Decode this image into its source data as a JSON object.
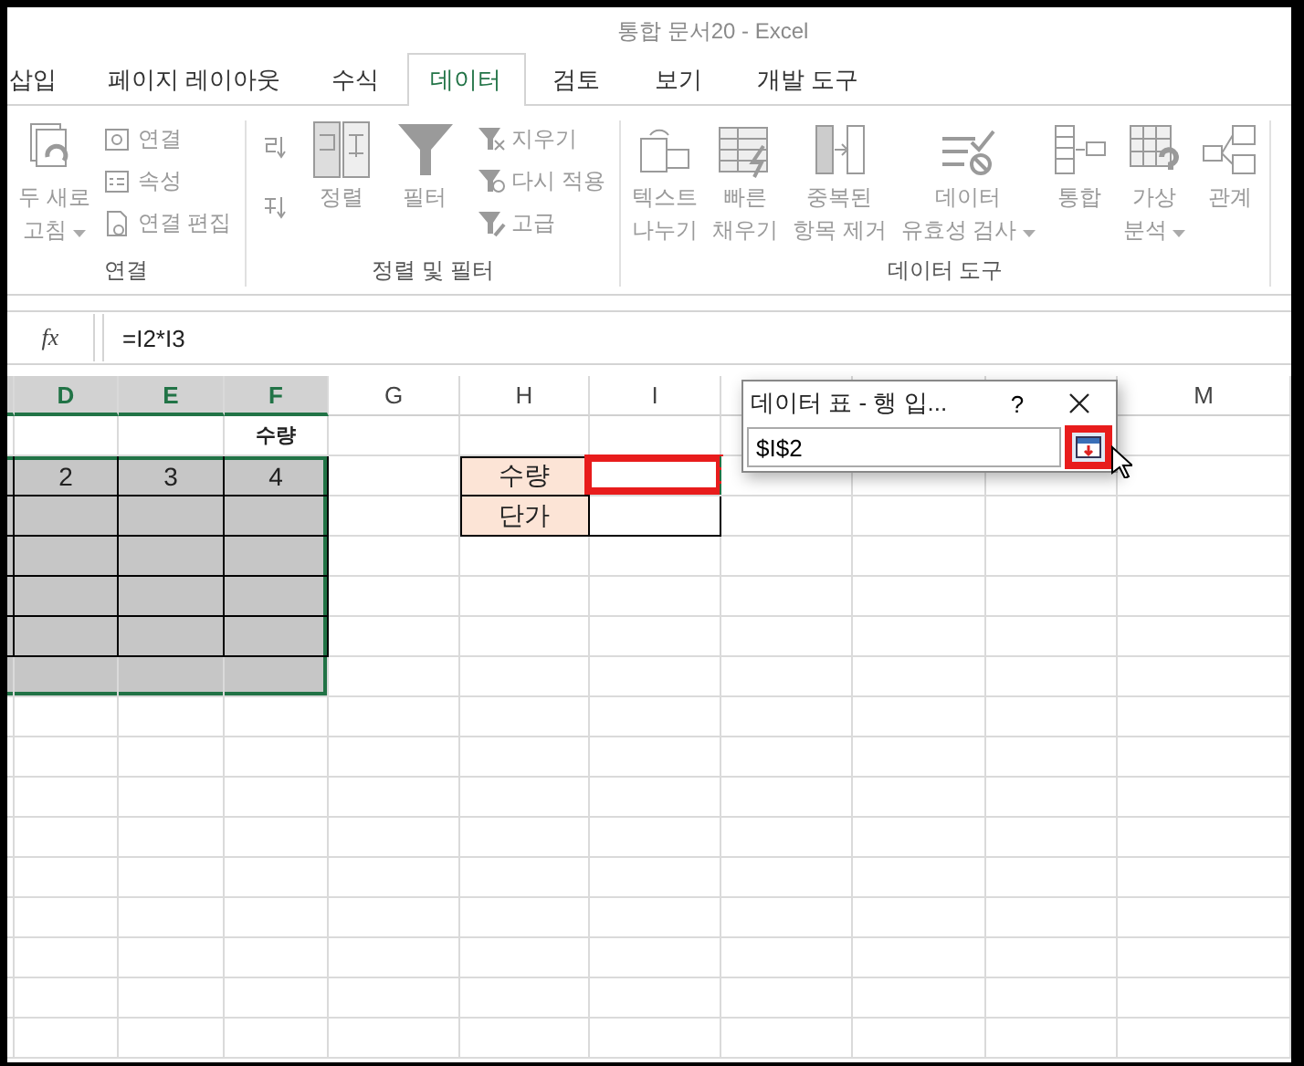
{
  "window": {
    "title": "통합 문서20 - Excel"
  },
  "tabs": [
    {
      "label": "삽입",
      "selected": false
    },
    {
      "label": "페이지 레이아웃",
      "selected": false
    },
    {
      "label": "수식",
      "selected": false
    },
    {
      "label": "데이터",
      "selected": true
    },
    {
      "label": "검토",
      "selected": false
    },
    {
      "label": "보기",
      "selected": false
    },
    {
      "label": "개발 도구",
      "selected": false
    }
  ],
  "ribbon": {
    "groups": [
      {
        "label": "연결",
        "buttons": [
          {
            "kind": "large",
            "lines": [
              "두 새로",
              "고침"
            ],
            "dropdown": true,
            "disabled": true
          },
          {
            "kind": "column",
            "items": [
              {
                "label": "연결",
                "disabled": true
              },
              {
                "label": "속성",
                "disabled": true
              },
              {
                "label": "연결 편집",
                "disabled": true
              }
            ]
          }
        ]
      },
      {
        "label": "정렬 및 필터",
        "buttons": [
          {
            "kind": "column",
            "items": [
              {
                "disabled": true
              },
              {
                "disabled": true
              }
            ]
          },
          {
            "kind": "large",
            "lines": [
              "정렬"
            ],
            "dropdown": false,
            "disabled": true
          },
          {
            "kind": "large",
            "lines": [
              "필터"
            ],
            "dropdown": false,
            "disabled": true
          },
          {
            "kind": "column",
            "items": [
              {
                "label": "지우기",
                "disabled": true
              },
              {
                "label": "다시 적용",
                "disabled": true
              },
              {
                "label": "고급",
                "disabled": true
              }
            ]
          }
        ]
      },
      {
        "label": "데이터 도구",
        "buttons": [
          {
            "kind": "large",
            "lines": [
              "텍스트",
              "나누기"
            ],
            "dropdown": false,
            "disabled": true
          },
          {
            "kind": "large",
            "lines": [
              "빠른",
              "채우기"
            ],
            "dropdown": false,
            "disabled": true
          },
          {
            "kind": "large",
            "lines": [
              "중복된",
              "항목 제거"
            ],
            "dropdown": false,
            "disabled": true
          },
          {
            "kind": "large",
            "lines": [
              "데이터",
              "유효성 검사"
            ],
            "dropdown": true,
            "disabled": true
          },
          {
            "kind": "large",
            "lines": [
              "통합"
            ],
            "dropdown": false,
            "disabled": true
          },
          {
            "kind": "large",
            "lines": [
              "가상",
              "분석"
            ],
            "dropdown": true,
            "disabled": true
          },
          {
            "kind": "large",
            "lines": [
              "관계"
            ],
            "dropdown": false,
            "disabled": true
          }
        ]
      }
    ]
  },
  "formula_bar": {
    "function_label": "fx",
    "formula": "=I2*I3"
  },
  "grid": {
    "columns": [
      {
        "kind": "cut"
      },
      {
        "kind": "full",
        "label": "D"
      },
      {
        "kind": "full",
        "label": "E"
      },
      {
        "kind": "full",
        "label": "F"
      },
      {
        "kind": "full",
        "label": "G"
      },
      {
        "kind": "full",
        "label": "H"
      },
      {
        "kind": "full",
        "label": "I"
      },
      {
        "kind": "covered"
      },
      {
        "kind": "covered"
      },
      {
        "kind": "covered"
      },
      {
        "kind": "full",
        "label": "M"
      }
    ],
    "rows": [
      [
        {
          "kind": "plain",
          "selected": false
        },
        {
          "kind": "plain",
          "selected": false
        },
        {
          "kind": "plain",
          "selected": false
        },
        {
          "kind": "heading",
          "selected": false,
          "text": "수량"
        },
        {
          "kind": "plain",
          "selected": false
        },
        {
          "kind": "plain",
          "selected": false
        },
        {
          "kind": "plain",
          "selected": false
        },
        {
          "kind": "plain",
          "selected": false
        },
        {
          "kind": "covered"
        },
        {
          "kind": "covered"
        },
        {
          "kind": "plain",
          "selected": false
        }
      ],
      [
        {
          "kind": "table",
          "selected": true
        },
        {
          "kind": "table",
          "selected": true,
          "text": "2"
        },
        {
          "kind": "table",
          "selected": true,
          "text": "3"
        },
        {
          "kind": "table",
          "selected": true,
          "text": "4"
        },
        {
          "kind": "plain",
          "selected": false
        },
        {
          "kind": "label",
          "selected": false,
          "text": "수량"
        },
        {
          "kind": "target",
          "selected": false
        },
        {
          "kind": "plain",
          "selected": false
        },
        {
          "kind": "plain",
          "selected": false
        },
        {
          "kind": "plain",
          "selected": false
        },
        {
          "kind": "plain",
          "selected": false
        }
      ],
      [
        {
          "kind": "table",
          "selected": true
        },
        {
          "kind": "table",
          "selected": true
        },
        {
          "kind": "table",
          "selected": true
        },
        {
          "kind": "table",
          "selected": true
        },
        {
          "kind": "plain",
          "selected": false
        },
        {
          "kind": "label",
          "selected": false,
          "text": "단가"
        },
        {
          "kind": "boxed",
          "selected": false
        },
        {
          "kind": "plain",
          "selected": false
        },
        {
          "kind": "plain",
          "selected": false
        },
        {
          "kind": "plain",
          "selected": false
        },
        {
          "kind": "plain",
          "selected": false
        }
      ],
      [
        {
          "kind": "table",
          "selected": true
        },
        {
          "kind": "table",
          "selected": true
        },
        {
          "kind": "table",
          "selected": true
        },
        {
          "kind": "table",
          "selected": true
        },
        {
          "kind": "plain",
          "selected": false
        },
        {
          "kind": "plain",
          "selected": false
        },
        {
          "kind": "plain",
          "selected": false
        },
        {
          "kind": "plain",
          "selected": false
        },
        {
          "kind": "plain",
          "selected": false
        },
        {
          "kind": "plain",
          "selected": false
        },
        {
          "kind": "plain",
          "selected": false
        }
      ],
      [
        {
          "kind": "table",
          "selected": true
        },
        {
          "kind": "table",
          "selected": true
        },
        {
          "kind": "table",
          "selected": true
        },
        {
          "kind": "table",
          "selected": true
        },
        {
          "kind": "plain",
          "selected": false
        },
        {
          "kind": "plain",
          "selected": false
        },
        {
          "kind": "plain",
          "selected": false
        },
        {
          "kind": "plain",
          "selected": false
        },
        {
          "kind": "plain",
          "selected": false
        },
        {
          "kind": "plain",
          "selected": false
        },
        {
          "kind": "plain",
          "selected": false
        }
      ],
      [
        {
          "kind": "table",
          "selected": true
        },
        {
          "kind": "table",
          "selected": true
        },
        {
          "kind": "table",
          "selected": true
        },
        {
          "kind": "table",
          "selected": true
        },
        {
          "kind": "plain",
          "selected": false
        },
        {
          "kind": "plain",
          "selected": false
        },
        {
          "kind": "plain",
          "selected": false
        },
        {
          "kind": "plain",
          "selected": false
        },
        {
          "kind": "plain",
          "selected": false
        },
        {
          "kind": "plain",
          "selected": false
        },
        {
          "kind": "plain",
          "selected": false
        }
      ],
      [
        {
          "kind": "plain",
          "selected": true
        },
        {
          "kind": "plain",
          "selected": true
        },
        {
          "kind": "plain",
          "selected": true
        },
        {
          "kind": "plain",
          "selected": true
        },
        {
          "kind": "plain",
          "selected": false
        },
        {
          "kind": "plain",
          "selected": false
        },
        {
          "kind": "plain",
          "selected": false
        },
        {
          "kind": "plain",
          "selected": false
        },
        {
          "kind": "plain",
          "selected": false
        },
        {
          "kind": "plain",
          "selected": false
        },
        {
          "kind": "plain",
          "selected": false
        }
      ]
    ]
  },
  "dialog": {
    "title": "데이터 표 - 행 입...",
    "help": "?",
    "input": {
      "value": "$I$2"
    }
  }
}
